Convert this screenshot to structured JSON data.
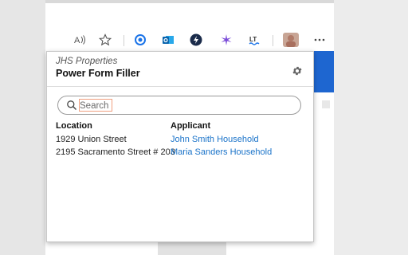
{
  "toolbar": {
    "icons": [
      {
        "name": "read-aloud-icon",
        "glyph": "Aᵀ"
      },
      {
        "name": "favorites-star-icon"
      },
      {
        "name": "extension-circle-icon"
      },
      {
        "name": "outlook-icon",
        "glyph": "O"
      },
      {
        "name": "bolt-extension-icon"
      },
      {
        "name": "sparkle-extension-icon"
      },
      {
        "name": "lt-extension-icon",
        "glyph": "LT"
      },
      {
        "name": "profile-avatar"
      },
      {
        "name": "more-menu-icon",
        "glyph": "⋯"
      }
    ]
  },
  "popup": {
    "org_name": "JHS Properties",
    "title": "Power Form Filler",
    "search_placeholder": "Search",
    "columns": {
      "location": "Location",
      "applicant": "Applicant"
    },
    "rows": [
      {
        "location": "1929 Union Street",
        "applicant": "John Smith Household"
      },
      {
        "location": "2195 Sacramento Street # 203",
        "applicant": "Maria Sanders Household"
      }
    ]
  },
  "colors": {
    "link": "#1a73c9",
    "accent_blue": "#1e66d0"
  }
}
